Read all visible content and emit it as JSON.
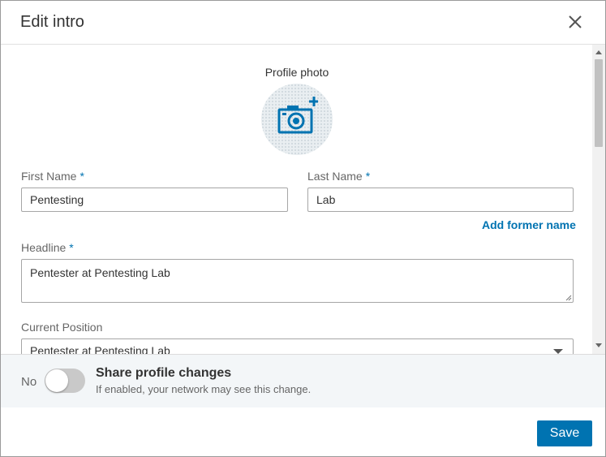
{
  "modal": {
    "title": "Edit intro"
  },
  "profile_photo": {
    "label": "Profile photo",
    "icon": "camera-plus-icon"
  },
  "form": {
    "first_name": {
      "label": "First Name",
      "required_mark": "*",
      "value": "Pentesting"
    },
    "last_name": {
      "label": "Last Name",
      "required_mark": "*",
      "value": "Lab"
    },
    "add_former_name": "Add former name",
    "headline": {
      "label": "Headline",
      "required_mark": "*",
      "value": "Pentester at Pentesting Lab"
    },
    "current_position": {
      "label": "Current Position",
      "value": "Pentester at Pentesting Lab"
    }
  },
  "share": {
    "toggle_state": "No",
    "title": "Share profile changes",
    "subtitle": "If enabled, your network may see this change."
  },
  "footer": {
    "save_label": "Save"
  },
  "colors": {
    "accent": "#0073b1",
    "share_bar_bg": "#f3f6f8",
    "toggle_off": "#c9c9c9"
  }
}
